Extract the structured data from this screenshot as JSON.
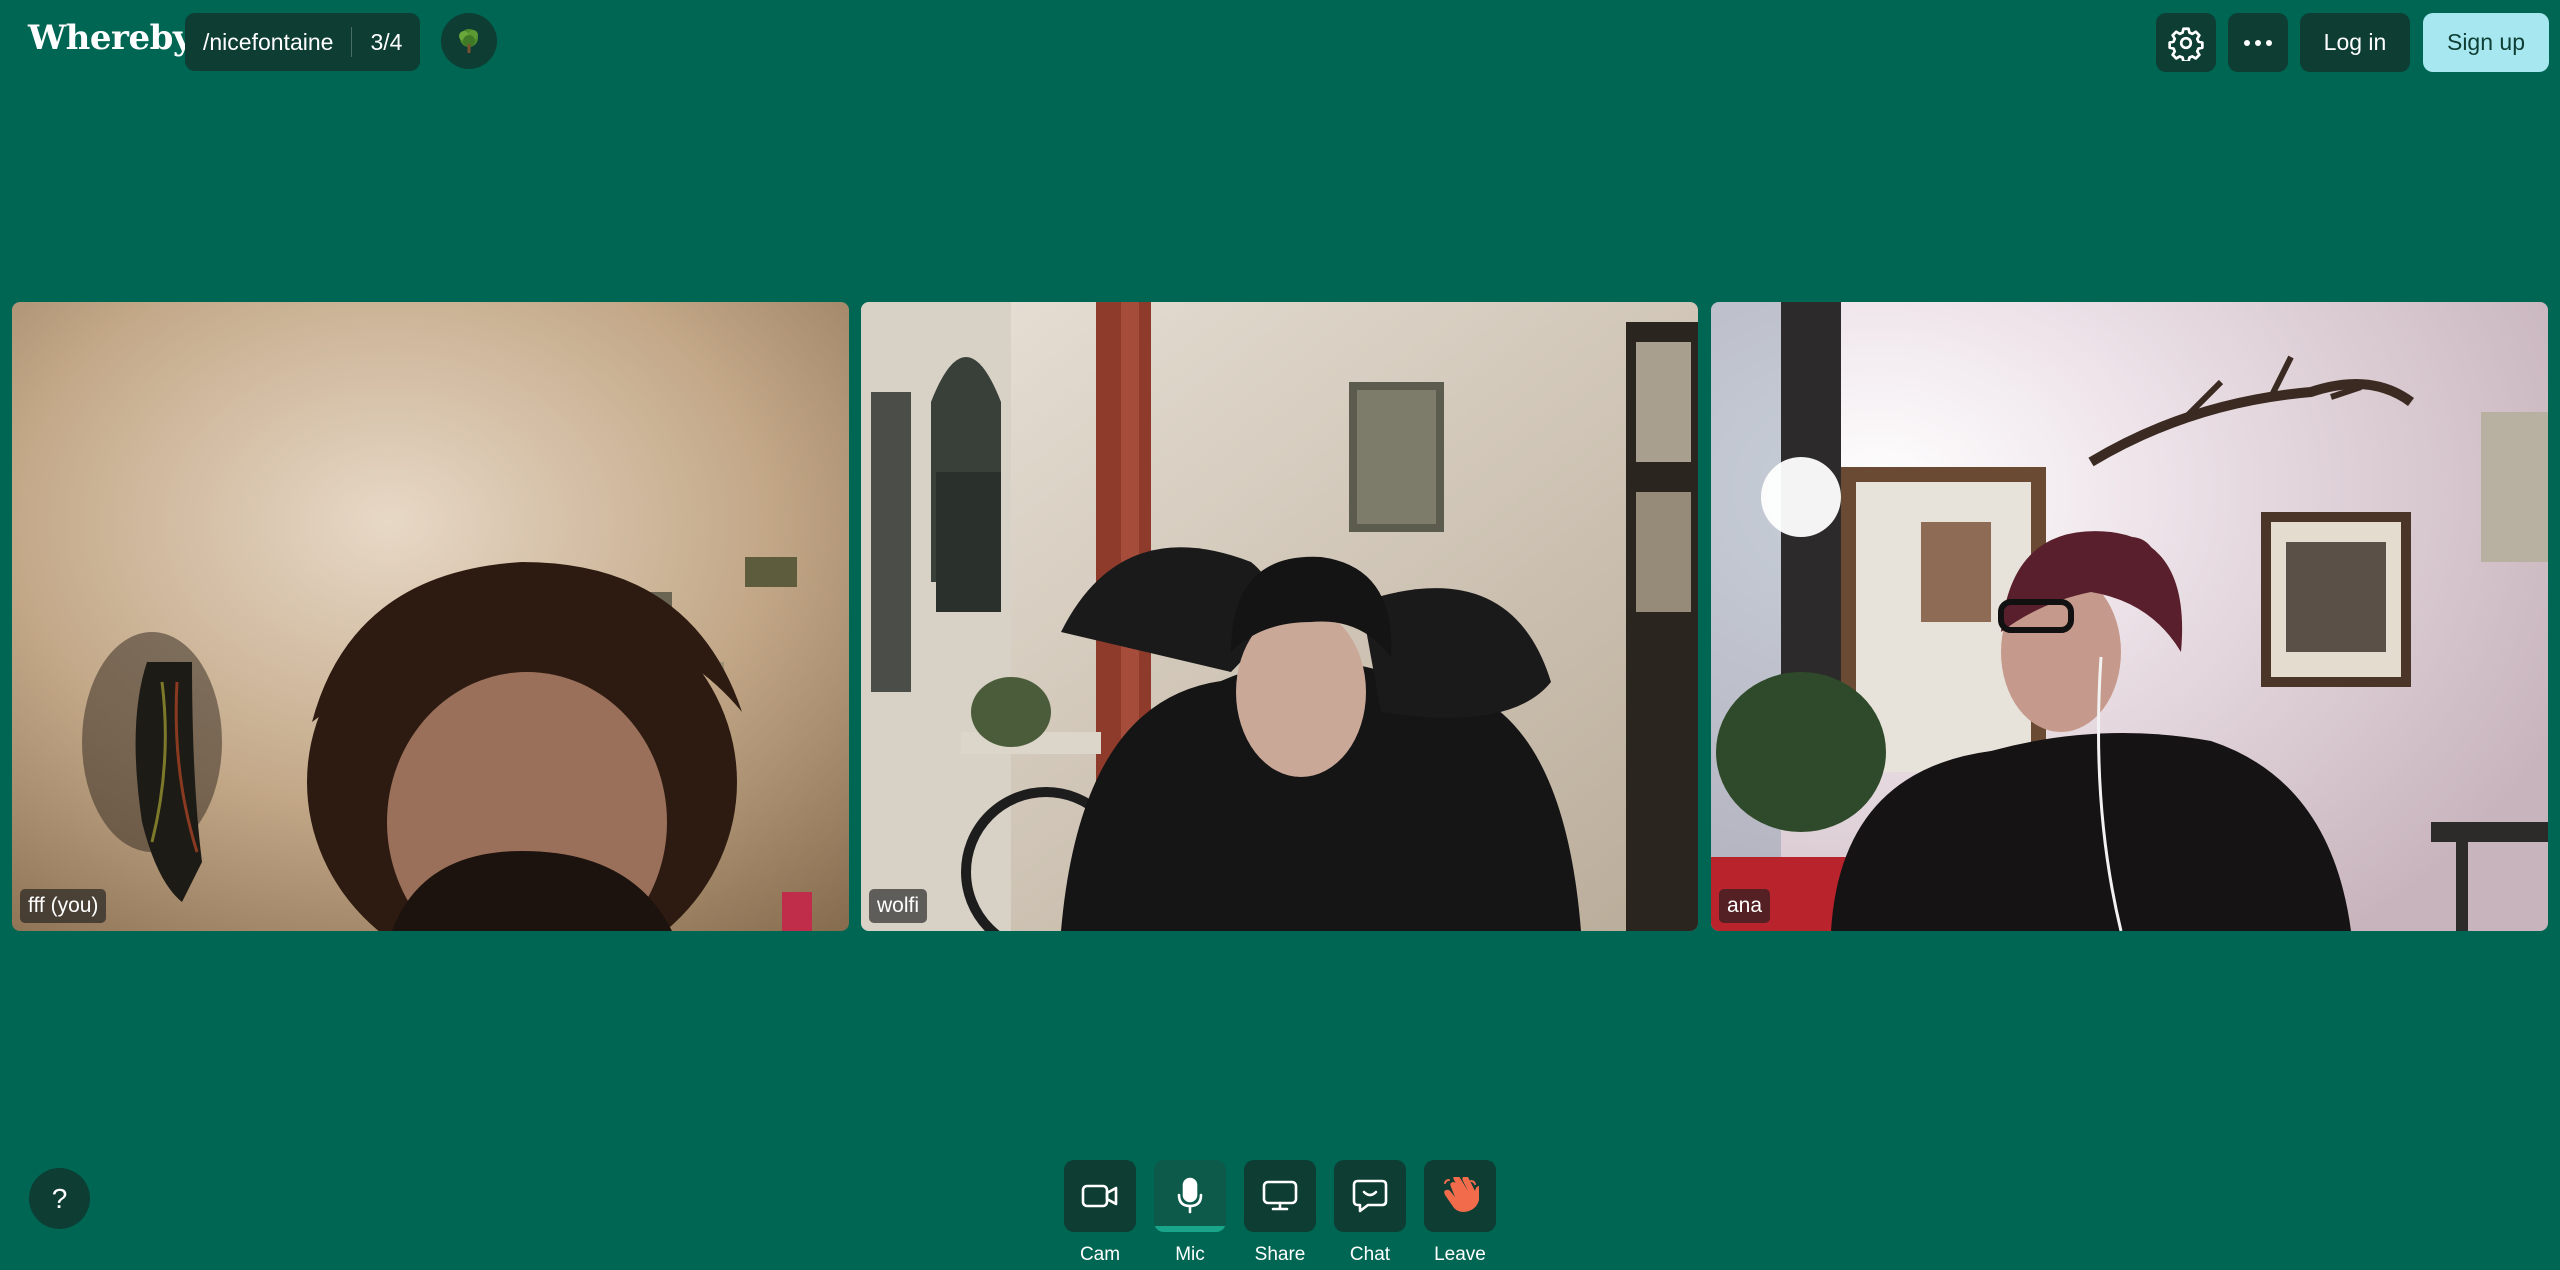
{
  "app": {
    "logo": "Whereby"
  },
  "room": {
    "name": "/nicefontaine",
    "count": "3/4"
  },
  "header": {
    "login_label": "Log in",
    "signup_label": "Sign up"
  },
  "participants": [
    {
      "name": "fff (you)"
    },
    {
      "name": "wolfi"
    },
    {
      "name": "ana"
    }
  ],
  "controls": [
    {
      "label": "Cam",
      "icon": "camera-icon"
    },
    {
      "label": "Mic",
      "icon": "microphone-icon",
      "active": true
    },
    {
      "label": "Share",
      "icon": "screen-share-icon"
    },
    {
      "label": "Chat",
      "icon": "chat-icon"
    },
    {
      "label": "Leave",
      "icon": "waving-hand-icon"
    }
  ],
  "help": {
    "label": "?"
  },
  "colors": {
    "background": "#006654",
    "button_dark": "#0d3d33",
    "signup": "#a7e8f0",
    "mic_active_bar": "#18a58a",
    "leave_hand": "#f26b4b"
  }
}
